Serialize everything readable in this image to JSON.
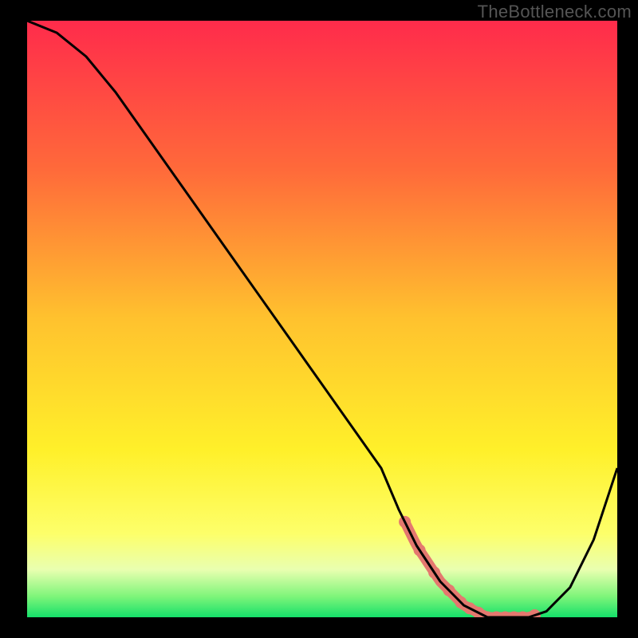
{
  "watermark": "TheBottleneck.com",
  "chart_data": {
    "type": "line",
    "title": "",
    "xlabel": "",
    "ylabel": "",
    "xlim": [
      0,
      100
    ],
    "ylim": [
      0,
      100
    ],
    "x": [
      0,
      5,
      10,
      15,
      20,
      25,
      30,
      35,
      40,
      45,
      50,
      55,
      60,
      63,
      66,
      70,
      74,
      78,
      82,
      85,
      88,
      92,
      96,
      100
    ],
    "values": [
      100,
      98,
      94,
      88,
      81,
      74,
      67,
      60,
      53,
      46,
      39,
      32,
      25,
      18,
      12,
      6,
      2,
      0,
      0,
      0,
      1,
      5,
      13,
      25
    ],
    "highlight_range_x": [
      64,
      86
    ],
    "gradient_stops": [
      {
        "offset": 0.0,
        "color": "#ff2b4b"
      },
      {
        "offset": 0.25,
        "color": "#ff6a3a"
      },
      {
        "offset": 0.5,
        "color": "#ffc22e"
      },
      {
        "offset": 0.72,
        "color": "#fff02a"
      },
      {
        "offset": 0.86,
        "color": "#fdff6a"
      },
      {
        "offset": 0.92,
        "color": "#e9ffb0"
      },
      {
        "offset": 0.965,
        "color": "#7ff57a"
      },
      {
        "offset": 1.0,
        "color": "#15e06a"
      }
    ],
    "highlight_dots_x": [
      64,
      66.5,
      69,
      71.5,
      73.5,
      75,
      76.5,
      78,
      79.5,
      81,
      82.5,
      84,
      86
    ]
  }
}
